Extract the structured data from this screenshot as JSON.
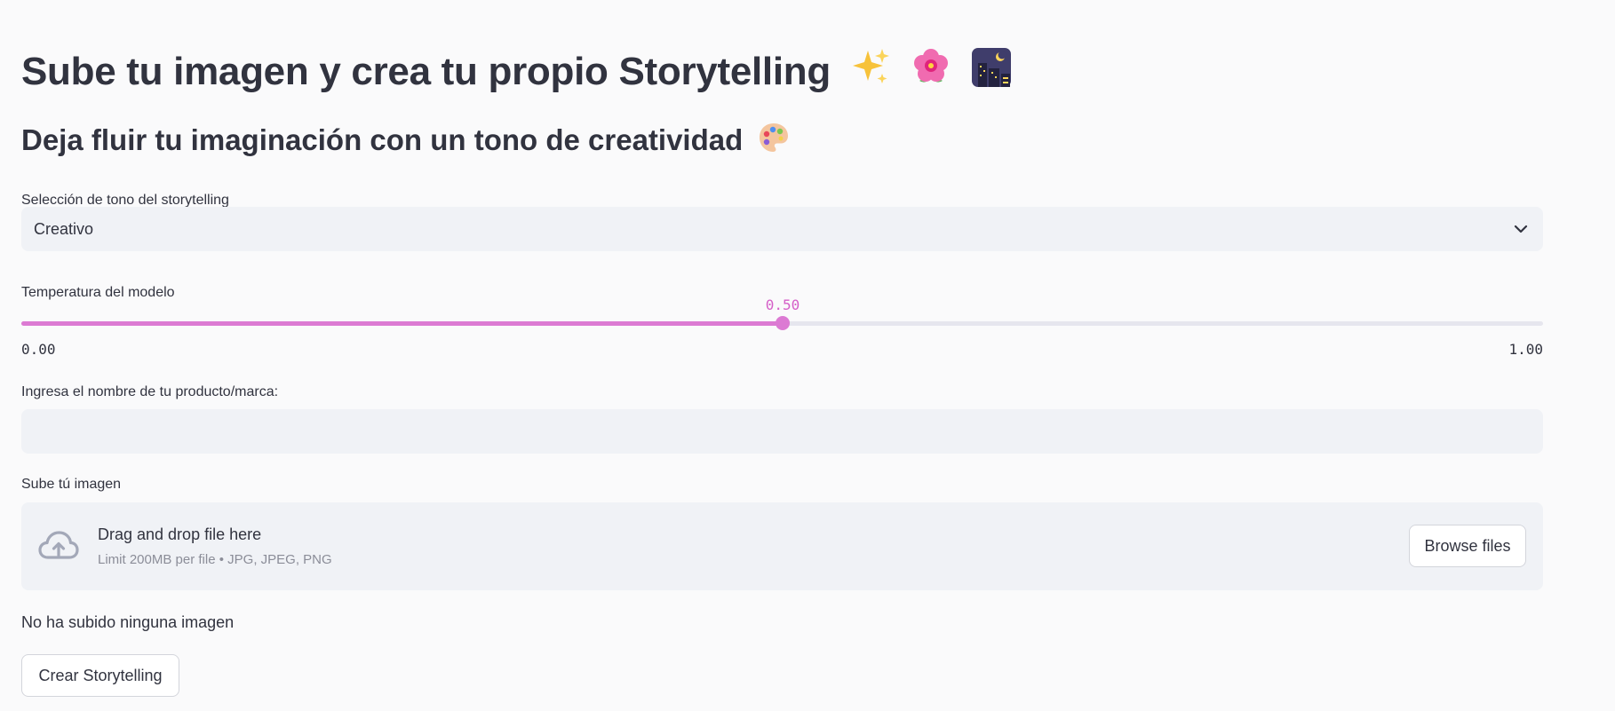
{
  "header": {
    "title": "Sube tu imagen y crea tu propio Storytelling",
    "title_emojis": [
      "sparkles-emoji",
      "flower-emoji",
      "night-city-emoji"
    ],
    "subtitle": "Deja fluir tu imaginación con un tono de creatividad",
    "subtitle_emoji": "palette-emoji"
  },
  "tone_select": {
    "label": "Selección de tono del storytelling",
    "value": "Creativo",
    "icon": "chevron-down-icon"
  },
  "temperature_slider": {
    "label": "Temperatura del modelo",
    "value": 0.5,
    "value_label": "0.50",
    "min": 0,
    "max": 1,
    "min_label": "0.00",
    "max_label": "1.00",
    "accent_color": "#dc7ad3"
  },
  "product_input": {
    "label": "Ingresa el nombre de tu producto/marca:",
    "value": "",
    "placeholder": ""
  },
  "uploader": {
    "label": "Sube tú imagen",
    "title": "Drag and drop file here",
    "limit": "Limit 200MB per file • JPG, JPEG, PNG",
    "browse_label": "Browse files",
    "icon": "cloud-upload-icon"
  },
  "status": {
    "text": "No ha subido ninguna imagen"
  },
  "actions": {
    "create_label": "Crear Storytelling"
  },
  "colors": {
    "background": "#fafafb",
    "widget_background": "#f0f2f6",
    "text": "#31333f",
    "accent": "#dc7ad3"
  }
}
